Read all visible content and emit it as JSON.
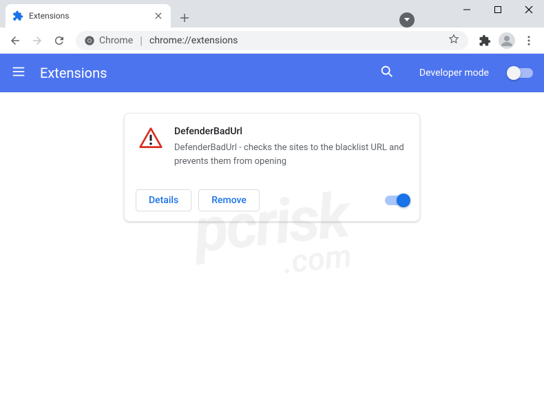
{
  "window": {
    "tab": {
      "title": "Extensions"
    },
    "omnibox": {
      "chip": "Chrome",
      "url": "chrome://extensions"
    }
  },
  "extHeader": {
    "title": "Extensions",
    "devModeLabel": "Developer mode"
  },
  "card": {
    "name": "DefenderBadUrl",
    "description": "DefenderBadUrl - checks the sites to the blacklist URL and prevents them from opening",
    "detailsLabel": "Details",
    "removeLabel": "Remove",
    "enabled": true
  },
  "watermark": {
    "main": "pcrisk",
    "sub": ".com"
  }
}
